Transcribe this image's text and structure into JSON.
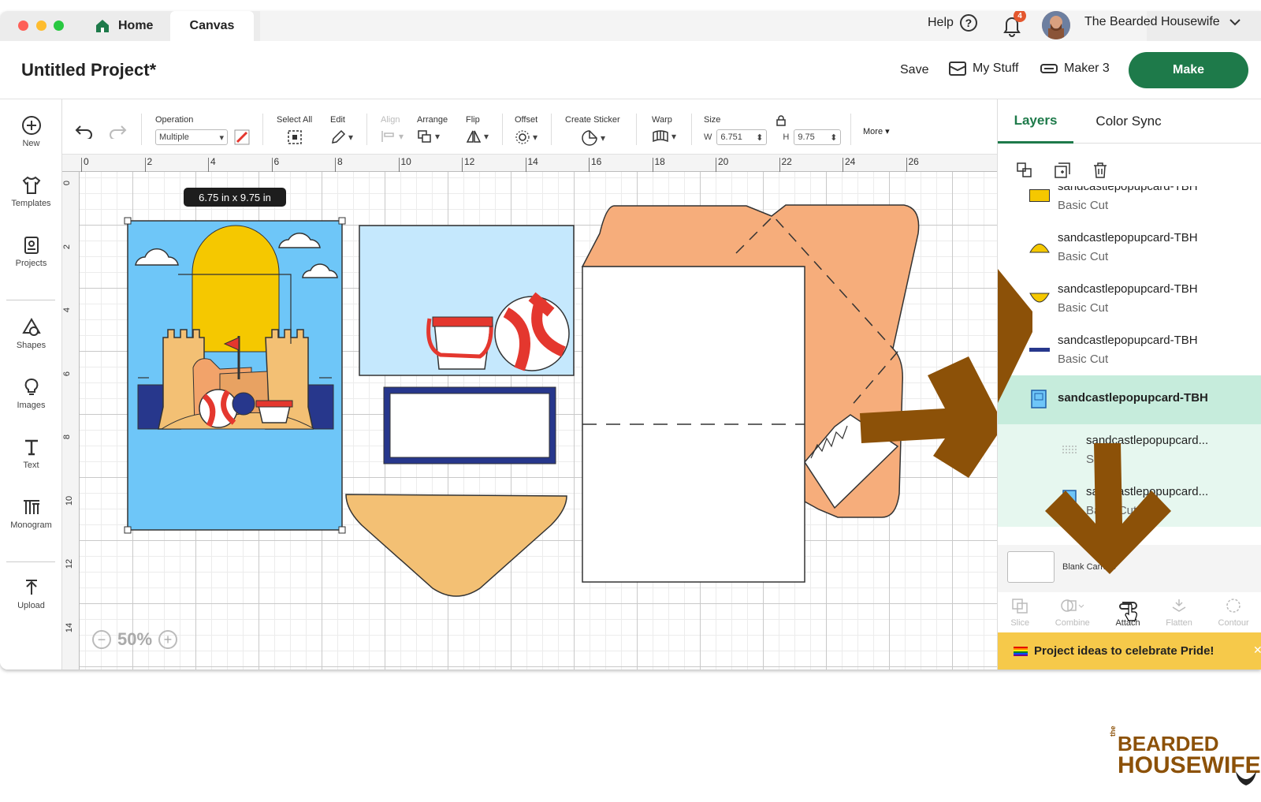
{
  "tabs": {
    "home": "Home",
    "canvas": "Canvas"
  },
  "topbar": {
    "help": "Help",
    "help_icon": "?",
    "notifications": "4",
    "user": "The Bearded Housewife"
  },
  "header": {
    "title": "Untitled Project*",
    "save": "Save",
    "my_stuff": "My Stuff",
    "machine": "Maker 3",
    "make": "Make"
  },
  "sidebar": {
    "items": [
      {
        "label": "New",
        "icon": "plus-circle-icon"
      },
      {
        "label": "Templates",
        "icon": "shirt-icon"
      },
      {
        "label": "Projects",
        "icon": "project-icon"
      },
      {
        "label": "Shapes",
        "icon": "shapes-icon"
      },
      {
        "label": "Images",
        "icon": "bulb-icon"
      },
      {
        "label": "Text",
        "icon": "text-icon"
      },
      {
        "label": "Monogram",
        "icon": "monogram-icon"
      },
      {
        "label": "Upload",
        "icon": "upload-icon"
      }
    ]
  },
  "toolbar": {
    "operation_label": "Operation",
    "operation_value": "Multiple",
    "select_all": "Select All",
    "edit": "Edit",
    "align": "Align",
    "arrange": "Arrange",
    "flip": "Flip",
    "offset": "Offset",
    "create_sticker": "Create Sticker",
    "warp": "Warp",
    "size": "Size",
    "w_label": "W",
    "w_value": "6.751",
    "h_label": "H",
    "h_value": "9.75",
    "more": "More"
  },
  "canvas": {
    "ruler_top": [
      "0",
      "2",
      "4",
      "6",
      "8",
      "10",
      "12",
      "14",
      "16",
      "18",
      "20",
      "22",
      "24",
      "26"
    ],
    "ruler_left": [
      "0",
      "2",
      "4",
      "6",
      "8",
      "10",
      "12",
      "14"
    ],
    "size_tooltip": "6.75  in x 9.75  in",
    "zoom": "50%"
  },
  "panel": {
    "tabs": [
      "Layers",
      "Color Sync"
    ],
    "layers": [
      {
        "name": "sandcastlepopupcard-TBH",
        "sub": "Basic Cut",
        "color": "#f5c800",
        "shape": "rect"
      },
      {
        "name": "sandcastlepopupcard-TBH",
        "sub": "Basic Cut",
        "color": "#f5c800",
        "shape": "half-top"
      },
      {
        "name": "sandcastlepopupcard-TBH",
        "sub": "Basic Cut",
        "color": "#f5c800",
        "shape": "half-bottom"
      },
      {
        "name": "sandcastlepopupcard-TBH",
        "sub": "Basic Cut",
        "color": "#27378c",
        "shape": "line"
      }
    ],
    "group": {
      "name": "sandcastlepopupcard-TBH"
    },
    "children": [
      {
        "name": "sandcastlepopupcard...",
        "sub": "Score"
      },
      {
        "name": "sandcastlepopupcard...",
        "sub": "Basic Cut"
      }
    ],
    "blank": "Blank Canvas",
    "actions": [
      "Slice",
      "Combine",
      "Attach",
      "Flatten",
      "Contour"
    ],
    "banner": "Project ideas to celebrate Pride!"
  },
  "logo": {
    "the": "the",
    "top": "BEARDED",
    "bottom": "HOUSEWIFE"
  },
  "colors": {
    "make": "#1e7a4a",
    "sky": "#6ec6f8",
    "sand": "#f3c074",
    "envelope": "#f6ad7b",
    "arrow": "#8c5108",
    "banner": "#f6c94a"
  }
}
